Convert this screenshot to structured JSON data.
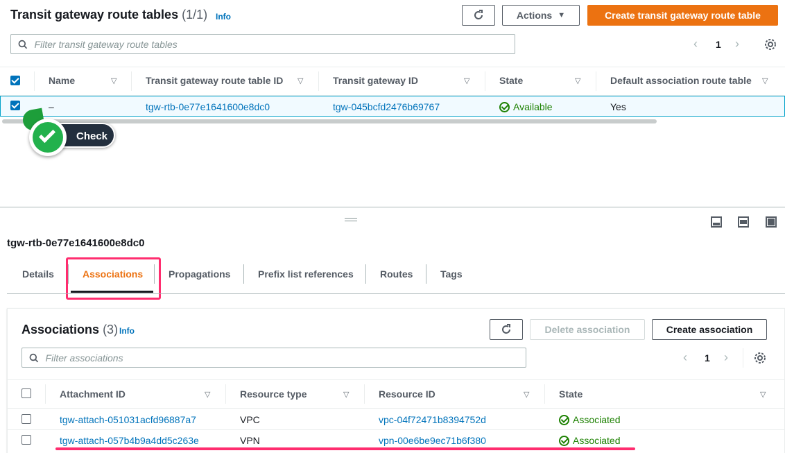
{
  "top": {
    "title": "Transit gateway route tables",
    "count": "(1/1)",
    "info": "Info",
    "actions_label": "Actions",
    "create_label": "Create transit gateway route table",
    "search_placeholder": "Filter transit gateway route tables",
    "page": "1",
    "columns": [
      "Name",
      "Transit gateway route table ID",
      "Transit gateway ID",
      "State",
      "Default association route table"
    ],
    "row": {
      "name": "–",
      "rtb_id": "tgw-rtb-0e77e1641600e8dc0",
      "tgw_id": "tgw-045bcfd2476b69767",
      "state": "Available",
      "default_assoc": "Yes"
    }
  },
  "callout": {
    "label": "Check"
  },
  "detail": {
    "heading": "tgw-rtb-0e77e1641600e8dc0",
    "tabs": [
      "Details",
      "Associations",
      "Propagations",
      "Prefix list references",
      "Routes",
      "Tags"
    ],
    "active_tab": "Associations"
  },
  "associations": {
    "title": "Associations",
    "count": "(3)",
    "info": "Info",
    "delete_label": "Delete association",
    "create_label": "Create association",
    "search_placeholder": "Filter associations",
    "page": "1",
    "columns": [
      "Attachment ID",
      "Resource type",
      "Resource ID",
      "State"
    ],
    "rows": [
      {
        "attachment": "tgw-attach-051031acfd96887a7",
        "type": "VPC",
        "resource": "vpc-04f72471b8394752d",
        "state": "Associated"
      },
      {
        "attachment": "tgw-attach-057b4b9a4dd5c263e",
        "type": "VPN",
        "resource": "vpn-00e6be9ec71b6f380",
        "state": "Associated"
      }
    ]
  },
  "colors": {
    "accent": "#ec7211",
    "link": "#0073bb",
    "success": "#1d8102",
    "highlight": "#ff2d6f",
    "callout_bg": "#232f3e"
  }
}
